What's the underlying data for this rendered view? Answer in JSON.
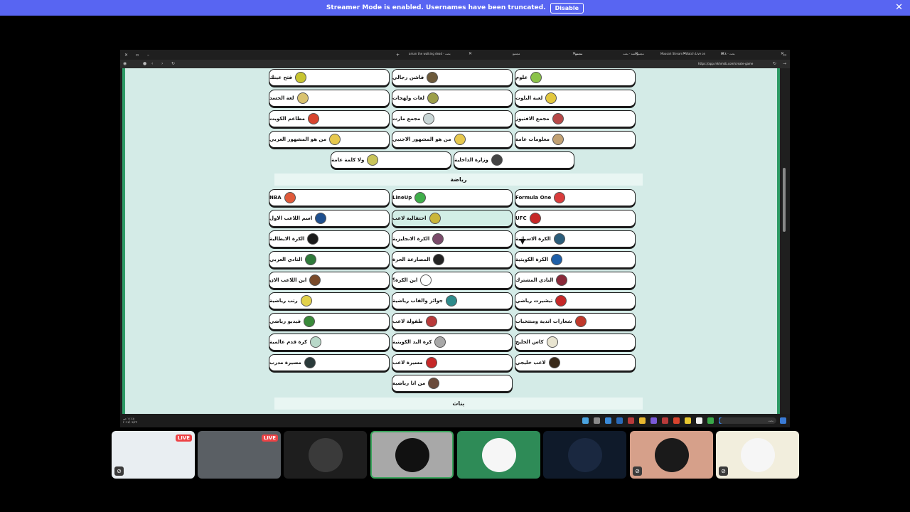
{
  "banner": {
    "text": "Streamer Mode is enabled. Usernames have been truncated.",
    "button": "Disable",
    "close": "✕"
  },
  "browser": {
    "tabs": [
      {
        "label": "aman the walking dead - بحث",
        "active": false
      },
      {
        "label": "مجتمع",
        "active": false
      },
      {
        "label": "مجتمع",
        "active": true
      },
      {
        "label": "مجتمع لعبة - بحث",
        "active": false
      },
      {
        "label": "Moosah Stream - Watch Live on",
        "active": false
      },
      {
        "label": "kick - بحث",
        "active": false
      }
    ],
    "url": "https://app.mkhmkb.com/create-game"
  },
  "sections": {
    "sports": "رياضة",
    "girls": "بنات"
  },
  "rows_top": [
    [
      {
        "label": "علوم",
        "icon": "science-icon",
        "color": "#8bc34a"
      },
      {
        "label": "فاشن رجالي",
        "icon": "fashion-icon",
        "color": "#6d5a3b"
      },
      {
        "label": "فتح عينك",
        "icon": "eye-icon",
        "color": "#c7c430"
      }
    ],
    [
      {
        "label": "لعبة البلوت",
        "icon": "cards-icon",
        "color": "#e2c73e"
      },
      {
        "label": "لغات ولهجات",
        "icon": "languages-icon",
        "color": "#9c9f4a"
      },
      {
        "label": "لغة الجسد",
        "icon": "body-icon",
        "color": "#d9c26f"
      }
    ],
    [
      {
        "label": "مجمع الافنيوز",
        "icon": "mall-icon",
        "color": "#b84848"
      },
      {
        "label": "مجمع مارت",
        "icon": "mart-icon",
        "color": "#c9d6d6"
      },
      {
        "label": "مطاعم الكويت",
        "icon": "restaurant-icon",
        "color": "#d8442e"
      }
    ],
    [
      {
        "label": "معلومات عامة",
        "icon": "info-icon",
        "color": "#c2a173"
      },
      {
        "label": "من هو المشهور الاجنبي",
        "icon": "celebrity-icon",
        "color": "#e7c84d"
      },
      {
        "label": "من هو المشهور العربي",
        "icon": "celebrity-arab-icon",
        "color": "#e7c84d"
      }
    ]
  ],
  "row_pair": [
    {
      "label": "وزارة الداخلية",
      "icon": "ministry-icon",
      "color": "#444"
    },
    {
      "label": "ولا كلمة عامة",
      "icon": "word-icon",
      "color": "#c9c45a"
    }
  ],
  "rows_sports": [
    [
      {
        "label": "Formula One",
        "icon": "f1-icon",
        "color": "#d93c3c"
      },
      {
        "label": "LineUp",
        "icon": "lineup-icon",
        "color": "#3fae4a"
      },
      {
        "label": "NBA",
        "icon": "nba-icon",
        "color": "#e05a3a"
      }
    ],
    [
      {
        "label": "UFC",
        "icon": "ufc-icon",
        "color": "#c62828"
      },
      {
        "label": "احتفالية لاعب",
        "icon": "celebration-icon",
        "color": "#c9b63a"
      },
      {
        "label": "اسم اللاعب الاول",
        "icon": "player-icon",
        "color": "#1e4f8e"
      }
    ],
    [
      {
        "label": "الكرة الاسبانية",
        "icon": "spain-ball-icon",
        "color": "#2b5d7a"
      },
      {
        "label": "الكرة الانجليزية",
        "icon": "england-ball-icon",
        "color": "#7a4a6a"
      },
      {
        "label": "الكرة الايطالية",
        "icon": "italy-ball-icon",
        "color": "#1a1a1a"
      }
    ],
    [
      {
        "label": "الكرة الكويتية",
        "icon": "kuwait-ball-icon",
        "color": "#1e5fa8"
      },
      {
        "label": "المصارعة الحرة",
        "icon": "wrestling-icon",
        "color": "#222"
      },
      {
        "label": "النادي العربي",
        "icon": "club-icon",
        "color": "#2f7a3a"
      }
    ],
    [
      {
        "label": "النادي المشترك",
        "icon": "shared-club-icon",
        "color": "#8a2a3a"
      },
      {
        "label": "اين الكرة؟",
        "icon": "ball-icon",
        "color": "#ffffff"
      },
      {
        "label": "اين اللاعب الان",
        "icon": "player-now-icon",
        "color": "#7a4a2a"
      }
    ],
    [
      {
        "label": "تيشيرت رياضي",
        "icon": "jersey-icon",
        "color": "#c62828"
      },
      {
        "label": "جوائز والقاب رياضية",
        "icon": "trophy-icon",
        "color": "#2e8b8b"
      },
      {
        "label": "رتب رياضية",
        "icon": "rank-icon",
        "color": "#e3d24a"
      }
    ],
    [
      {
        "label": "شعارات اندية ومنتخبات",
        "icon": "logo-icon",
        "color": "#c0392b"
      },
      {
        "label": "طفولة لاعب",
        "icon": "childhood-icon",
        "color": "#b83a3a"
      },
      {
        "label": "فيديو رياضي",
        "icon": "video-icon",
        "color": "#3a8a3a"
      }
    ],
    [
      {
        "label": "كاس الخليج",
        "icon": "gulf-cup-icon",
        "color": "#e8e4d0"
      },
      {
        "label": "كرة اليد الكويتية",
        "icon": "handball-icon",
        "color": "#a8a8a8"
      },
      {
        "label": "كرة قدم عالمية",
        "icon": "world-football-icon",
        "color": "#b8d8c8"
      }
    ],
    [
      {
        "label": "لاعب خليجي",
        "icon": "gulf-player-icon",
        "color": "#3a2a1a"
      },
      {
        "label": "مسيرة لاعب",
        "icon": "career-icon",
        "color": "#c62828"
      },
      {
        "label": "مسيرة مدرب",
        "icon": "coach-icon",
        "color": "#2a3a3a"
      }
    ]
  ],
  "single_card": {
    "label": "من انا رياضية",
    "icon": "whoami-icon",
    "color": "#6a4a3a"
  },
  "taskbar": {
    "search": "بحث",
    "time": "١١:٤٥ ص",
    "date": "٢٠٢٤/٠٩/٢٣"
  },
  "participants": [
    {
      "live": "LIVE",
      "bg": "#e9eef2"
    },
    {
      "live": "LIVE",
      "bg": "#5a5f64"
    },
    {
      "bg": "#1e1e1e"
    },
    {
      "bg": "#a8a8a8"
    },
    {
      "bg": "#2e8b57"
    },
    {
      "bg": "#0f1a2a"
    },
    {
      "bg": "#d6a08a"
    },
    {
      "bg": "#f2eedd"
    }
  ]
}
